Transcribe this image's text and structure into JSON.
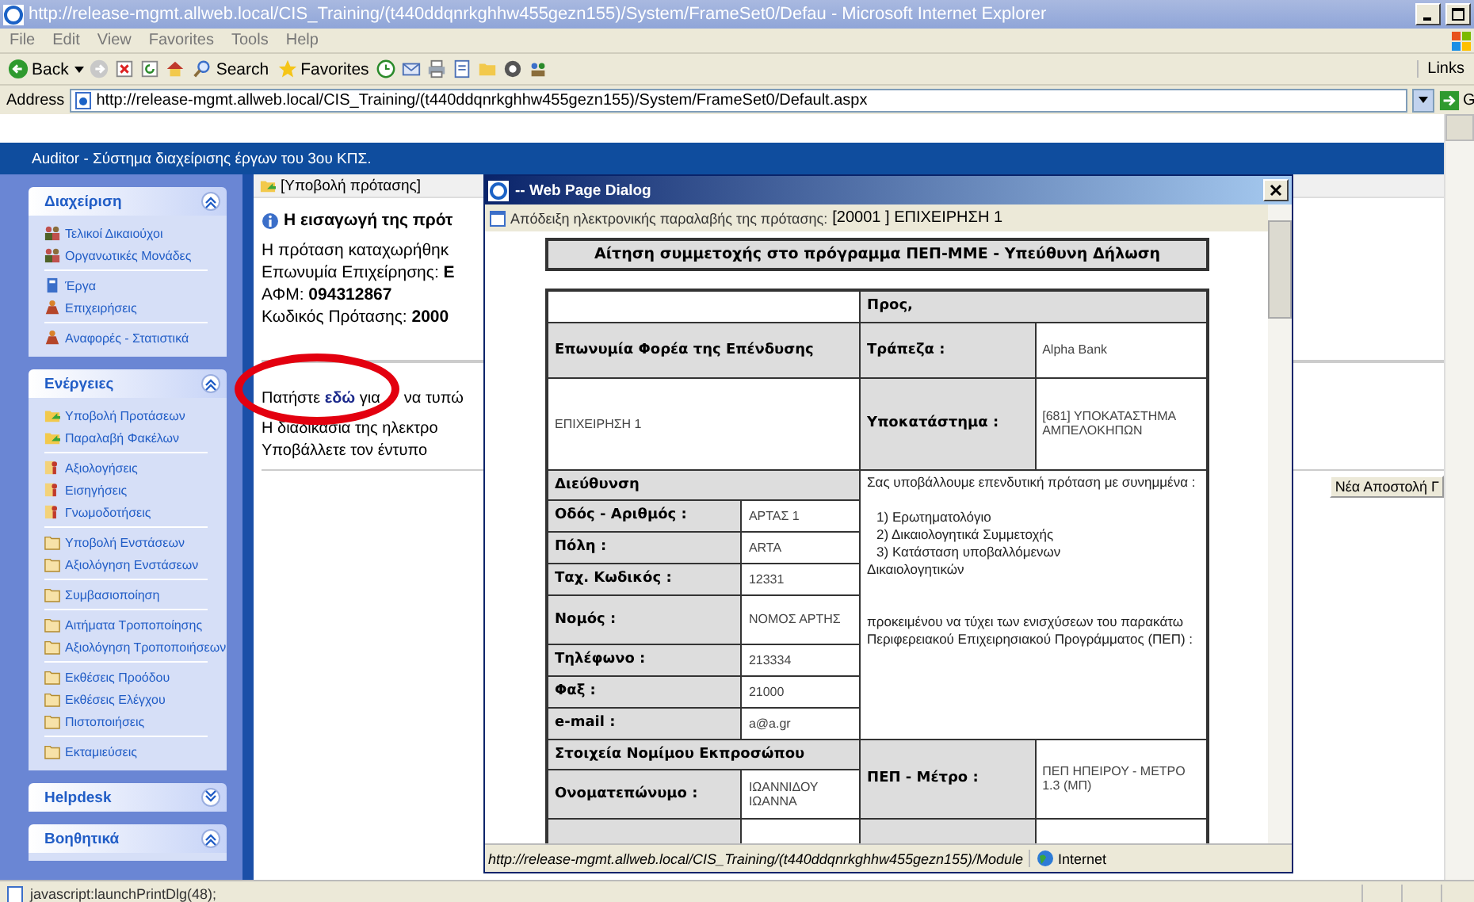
{
  "window": {
    "title": "http://release-mgmt.allweb.local/CIS_Training/(t440ddqnrkghhw455gezn155)/System/FrameSet0/Defau - Microsoft Internet Explorer"
  },
  "menu": [
    "File",
    "Edit",
    "View",
    "Favorites",
    "Tools",
    "Help"
  ],
  "toolbar": [
    {
      "kind": "back",
      "label": "Back"
    },
    {
      "kind": "forward"
    },
    {
      "kind": "stop"
    },
    {
      "kind": "refresh"
    },
    {
      "kind": "home"
    },
    {
      "kind": "search",
      "label": "Search"
    },
    {
      "kind": "favorites",
      "label": "Favorites"
    },
    {
      "kind": "history"
    },
    {
      "kind": "mail"
    },
    {
      "kind": "print"
    },
    {
      "kind": "edit"
    },
    {
      "kind": "folder"
    },
    {
      "kind": "messenger"
    },
    {
      "kind": "research"
    }
  ],
  "links_label": "Links",
  "address": {
    "label": "Address",
    "value": "http://release-mgmt.allweb.local/CIS_Training/(t440ddqnrkghhw455gezn155)/System/FrameSet0/Default.aspx",
    "go": "G"
  },
  "app_banner": "Auditor - Σύστημα διαχείρισης έργων του 3ου ΚΠΣ.",
  "sidebar": {
    "panels": [
      {
        "title": "Διαχείριση",
        "expanded": true,
        "groups": [
          {
            "items": [
              {
                "label": "Τελικοί Δικαιούχοι",
                "kind": "people"
              },
              {
                "label": "Οργανωτικές Μονάδες",
                "kind": "people"
              }
            ]
          },
          {
            "items": [
              {
                "label": "Έργα",
                "kind": "book"
              },
              {
                "label": "Επιχειρήσεις",
                "kind": "figure"
              }
            ]
          },
          {
            "items": [
              {
                "label": "Αναφορές - Στατιστικά",
                "kind": "figure"
              }
            ]
          }
        ]
      },
      {
        "title": "Ενέργειες",
        "expanded": true,
        "groups": [
          {
            "items": [
              {
                "label": "Υποβολή Προτάσεων",
                "kind": "folder-arrow"
              },
              {
                "label": "Παραλαβή Φακέλων",
                "kind": "folder-arrow"
              }
            ]
          },
          {
            "items": [
              {
                "label": "Αξιολογήσεις",
                "kind": "person"
              },
              {
                "label": "Εισηγήσεις",
                "kind": "person"
              },
              {
                "label": "Γνωμοδοτήσεις",
                "kind": "person"
              }
            ]
          },
          {
            "items": [
              {
                "label": "Υποβολή Ενστάσεων",
                "kind": "folder"
              },
              {
                "label": "Αξιολόγηση Ενστάσεων",
                "kind": "folder"
              }
            ]
          },
          {
            "items": [
              {
                "label": "Συμβασιοποίηση",
                "kind": "folder"
              }
            ]
          },
          {
            "items": [
              {
                "label": "Αιτήματα Τροποποίησης",
                "kind": "folder"
              },
              {
                "label": "Αξιολόγηση Τροποποιήσεων",
                "kind": "folder"
              }
            ]
          },
          {
            "items": [
              {
                "label": "Εκθέσεις Προόδου",
                "kind": "folder"
              },
              {
                "label": "Εκθέσεις Ελέγχου",
                "kind": "folder"
              },
              {
                "label": "Πιστοποιήσεις",
                "kind": "folder"
              }
            ]
          },
          {
            "items": [
              {
                "label": "Εκταμιεύσεις",
                "kind": "folder"
              }
            ]
          }
        ]
      },
      {
        "title": "Helpdesk",
        "expanded": false
      },
      {
        "title": "Βοηθητικά",
        "expanded": true
      }
    ]
  },
  "content": {
    "title": "[Υποβολή πρότασης]",
    "heading": "Η εισαγωγή της πρότ",
    "details": [
      "Η πρόταση καταχωρήθηκ",
      "Επωνυμία Επιχείρησης: **Ε**",
      "ΑΦΜ: **094312867**",
      "Κωδικός Πρότασης: **2000**"
    ],
    "instruction_link": {
      "before": "Πατήστε ",
      "link": "εδώ",
      "after": " για",
      "rest": "να τυπώ"
    },
    "instructions": [
      "Η διαδικασία της ηλεκτρο",
      "Υποβάλλετε τον έντυπο"
    ],
    "new_send_button": "Νέα Αποστολή Γ"
  },
  "dialog": {
    "title": "-- Web Page Dialog",
    "subtitle": "Απόδειξη ηλεκτρονικής παραλαβής της πρότασης:",
    "subtitle_code": "[20001 ] ΕΠΙΧΕΙΡΗΣΗ 1",
    "form_title": "Αίτηση συμμετοχής στο πρόγραμμα ΠΕΠ-ΜΜΕ - Υπεύθυνη Δήλωση",
    "table": {
      "to_header": "Προς,",
      "investor_label": "Επωνυμία Φορέα της Επένδυσης",
      "investor_name": "ΕΠΙΧΕΙΡΗΣΗ 1",
      "bank": {
        "label": "Τράπεζα :",
        "value": "Alpha Bank"
      },
      "branch": {
        "label": "Υποκατάστημα :",
        "value": "[681] ΥΠΟΚΑΤΑΣΤΗΜΑ ΑΜΠΕΛΟΚΗΠΩΝ"
      },
      "address_header": "Διεύθυνση",
      "address_fields": [
        {
          "label": "Οδός - Αριθμός :",
          "value": "ΑΡΤΑΣ 1"
        },
        {
          "label": "Πόλη :",
          "value": "ARTA"
        },
        {
          "label": "Ταχ. Κωδικός :",
          "value": "12331"
        },
        {
          "label": "Νομός :",
          "value": "ΝΟΜΟΣ ΑΡΤΗΣ"
        },
        {
          "label": "Τηλέφωνο :",
          "value": "213334"
        },
        {
          "label": "Φαξ :",
          "value": "21000"
        },
        {
          "label": "e-mail :",
          "value": "a@a.gr"
        }
      ],
      "declaration": {
        "intro": "Σας υποβάλλουμε επενδυτική πρόταση με συνημμένα :",
        "attachments": [
          "1) Ερωτηματολόγιο",
          "2) Δικαιολογητικά Συμμετοχής",
          "3) Κατάσταση υποβαλλόμενων"
        ],
        "attachment_tail": "Δικαιολογητικών",
        "closing": "προκειμένου να τύχει των ενισχύσεων του παρακάτω Περιφερειακού Επιχειρησιακού Προγράμματος (ΠΕΠ) :"
      },
      "representative_header": "Στοιχεία Νομίμου Εκπροσώπου",
      "representative_fields": [
        {
          "label": "Ονοματεπώνυμο :",
          "value": "ΙΩΑΝΝΙΔΟΥ ΙΩΑΝΝΑ"
        }
      ],
      "program": {
        "label": "ΠΕΠ - Μέτρο :",
        "value": "ΠΕΠ ΗΠΕΙΡΟΥ - ΜΕΤΡΟ 1.3 (ΜΠ)"
      }
    },
    "status_url": "http://release-mgmt.allweb.local/CIS_Training/(t440ddqnrkghhw455gezn155)/Module",
    "zone": "Internet"
  },
  "status_bar": {
    "text": "javascript:launchPrintDlg(48);"
  }
}
